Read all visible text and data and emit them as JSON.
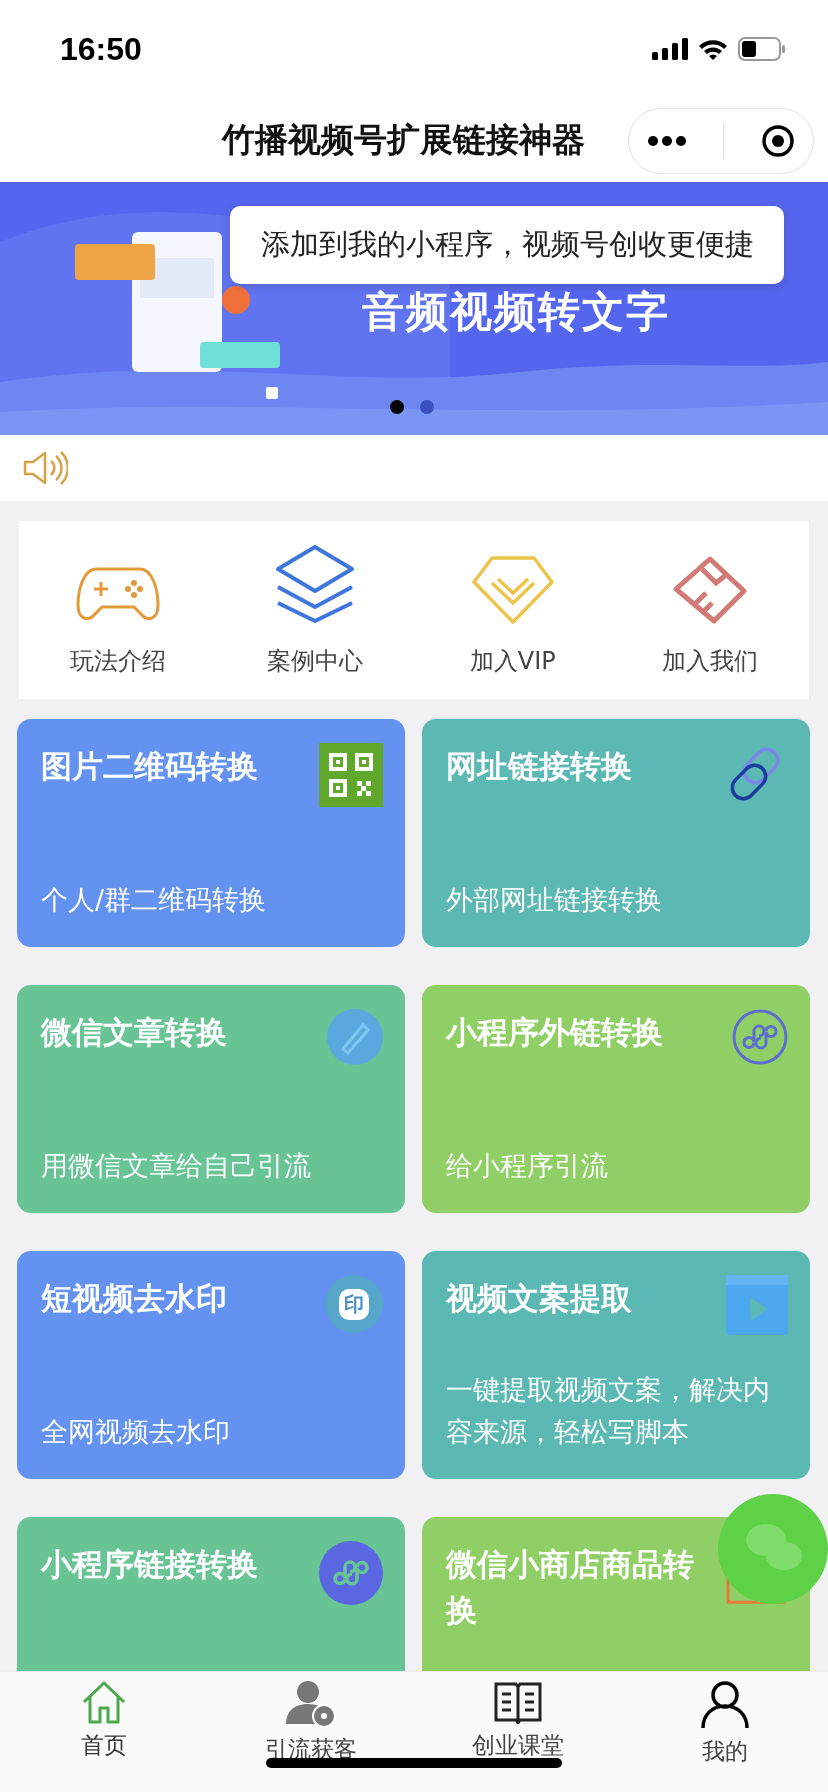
{
  "status_bar": {
    "time": "16:50"
  },
  "nav": {
    "title": "竹播视频号扩展链接神器"
  },
  "tooltip": {
    "text": "添加到我的小程序，视频号创收更便捷"
  },
  "banner": {
    "headline": "音频视频转文字",
    "dots": [
      {
        "selected": true
      },
      {
        "selected": false
      }
    ]
  },
  "shortcuts": [
    {
      "label": "玩法介绍",
      "kind": "gamepad"
    },
    {
      "label": "案例中心",
      "kind": "layers"
    },
    {
      "label": "加入VIP",
      "kind": "vip"
    },
    {
      "label": "加入我们",
      "kind": "handshake"
    }
  ],
  "cards": [
    {
      "title": "图片二维码转换",
      "subtitle": "个人/群二维码转换",
      "color": "#6492f1",
      "kind": "qr"
    },
    {
      "title": "网址链接转换",
      "subtitle": "外部网址链接转换",
      "color": "#5bb8b3",
      "kind": "link"
    },
    {
      "title": "微信文章转换",
      "subtitle": "用微信文章给自己引流",
      "color": "#68c495",
      "kind": "pen"
    },
    {
      "title": "小程序外链转换",
      "subtitle": "给小程序引流",
      "color": "#90cf65",
      "kind": "mini"
    },
    {
      "title": "短视频去水印",
      "subtitle": "全网视频去水印",
      "color": "#6492f1",
      "kind": "stamp",
      "glyph": "印"
    },
    {
      "title": "视频文案提取",
      "subtitle": "一键提取视频文案，解决内容来源，轻松写脚本",
      "color": "#5bb8b3",
      "kind": "video"
    },
    {
      "title": "小程序链接转换",
      "color": "#68c495",
      "kind": "minifill"
    },
    {
      "title": "微信小商店商品转换",
      "color": "#90cf65",
      "kind": "shop"
    }
  ],
  "tabs": [
    {
      "label": "首页",
      "kind": "home",
      "selected": true
    },
    {
      "label": "引流获客",
      "kind": "users",
      "selected": false
    },
    {
      "label": "创业课堂",
      "kind": "book",
      "selected": false
    },
    {
      "label": "我的",
      "kind": "person",
      "selected": false
    }
  ]
}
